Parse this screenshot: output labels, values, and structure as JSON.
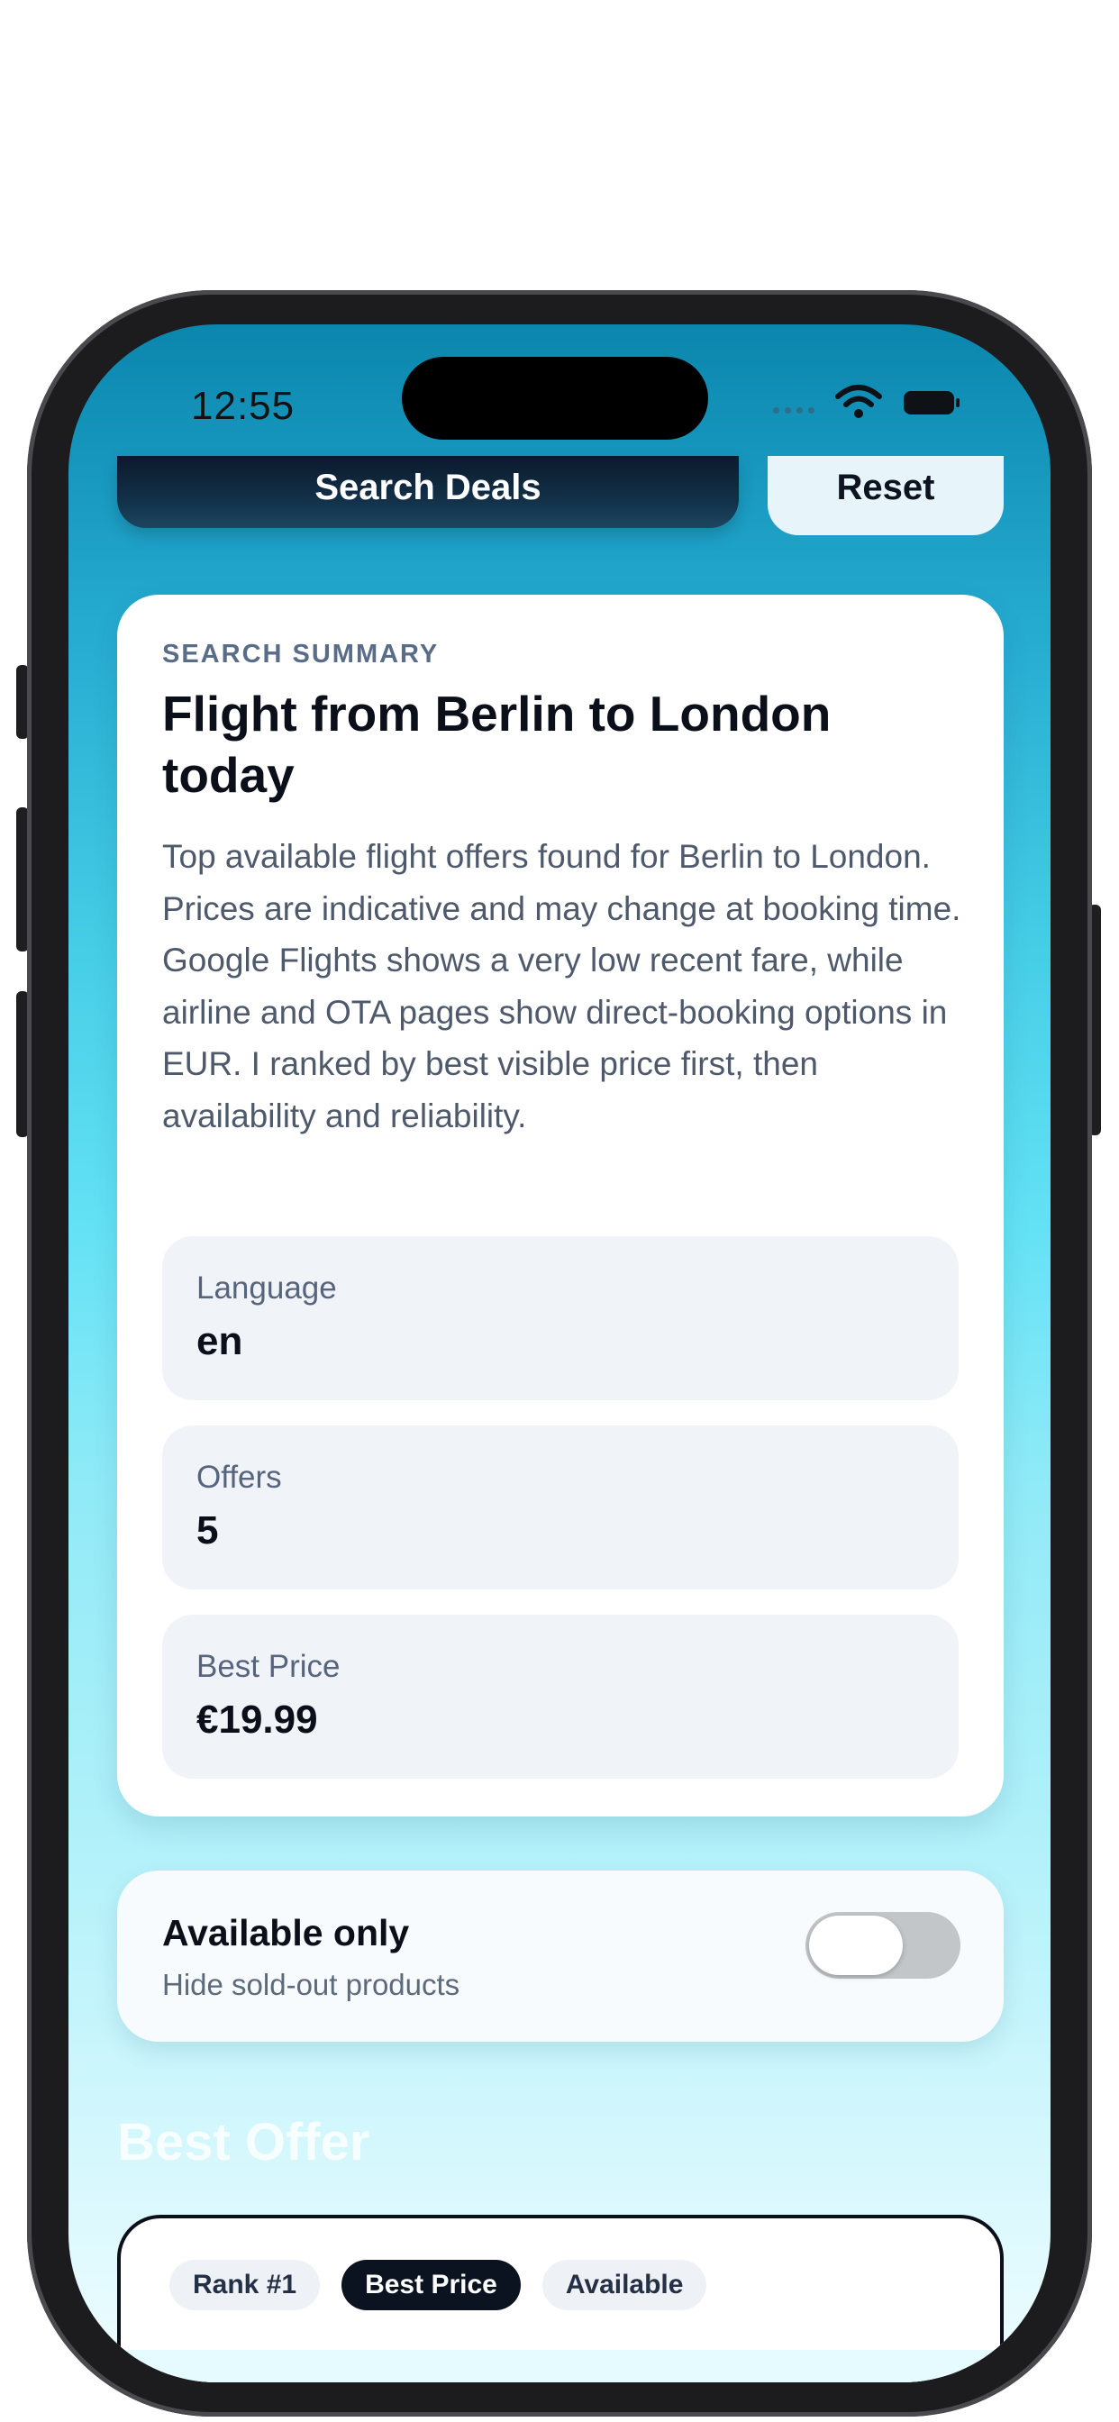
{
  "status_bar": {
    "time": "12:55"
  },
  "actions": {
    "search_label": "Search Deals",
    "reset_label": "Reset"
  },
  "summary": {
    "eyebrow": "SEARCH SUMMARY",
    "title": "Flight from Berlin to London today",
    "description": "Top available flight offers found for Berlin to London. Prices are indicative and may change at booking time. Google Flights shows a very low recent fare, while airline and OTA pages show direct-booking options in EUR. I ranked by best visible price first, then availability and reliability.",
    "stats": [
      {
        "label": "Language",
        "value": "en"
      },
      {
        "label": "Offers",
        "value": "5"
      },
      {
        "label": "Best Price",
        "value": "€19.99"
      }
    ]
  },
  "filter": {
    "title": "Available only",
    "subtitle": "Hide sold-out products",
    "enabled": false
  },
  "best_offer": {
    "heading": "Best Offer",
    "chips": [
      "Rank #1",
      "Best Price",
      "Available"
    ]
  }
}
